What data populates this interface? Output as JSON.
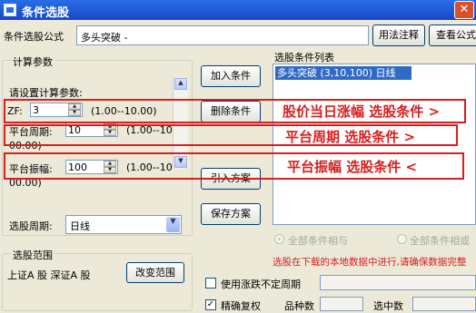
{
  "window": {
    "title": "条件选股",
    "close_glyph": "✕"
  },
  "formula": {
    "label": "条件选股公式",
    "value": "多头突破 -",
    "usage_button": "用法注释",
    "view_button": "查看公式"
  },
  "params": {
    "group_label": "计算参数",
    "prompt": "请设置计算参数:",
    "rows": [
      {
        "label": "ZF:",
        "value": "3",
        "range": "(1.00--10.00)"
      },
      {
        "label": "平台周期:",
        "value": "10",
        "range_a": "(1.00--10",
        "range_b": "00.00)"
      },
      {
        "label": "平台振幅:",
        "value": "100",
        "range_a": "(1.00--10",
        "range_b": "00.00)"
      }
    ]
  },
  "period": {
    "label": "选股周期:",
    "value": "日线"
  },
  "scope": {
    "group_label": "选股范围",
    "text": "上证A 股 深证A 股",
    "change_button": "改变范围"
  },
  "buttons": {
    "add": "加入条件",
    "delete": "删除条件",
    "import": "引入方案",
    "save": "保存方案"
  },
  "condition_list": {
    "label": "选股条件列表",
    "items": [
      "多头突破 (3,10,100) 日线"
    ]
  },
  "annotations": [
    "股价当日涨幅 选股条件 >",
    "平台周期 选股条件 >",
    "平台振幅 选股条件 <"
  ],
  "logic": {
    "and_label": "全部条件相与",
    "or_label": "全部条件相或"
  },
  "warning": "选股在下载的本地数据中进行,请确保数据完整",
  "options": {
    "unfixed_period": "使用涨跌不定周期",
    "exact_restore": "精确复权",
    "variety_count": "品种数",
    "selected_count": "选中数"
  },
  "colors": {
    "title_bar": "#1f5fd8",
    "annotation_red": "#d81e1e",
    "selection": "#316ac5"
  }
}
